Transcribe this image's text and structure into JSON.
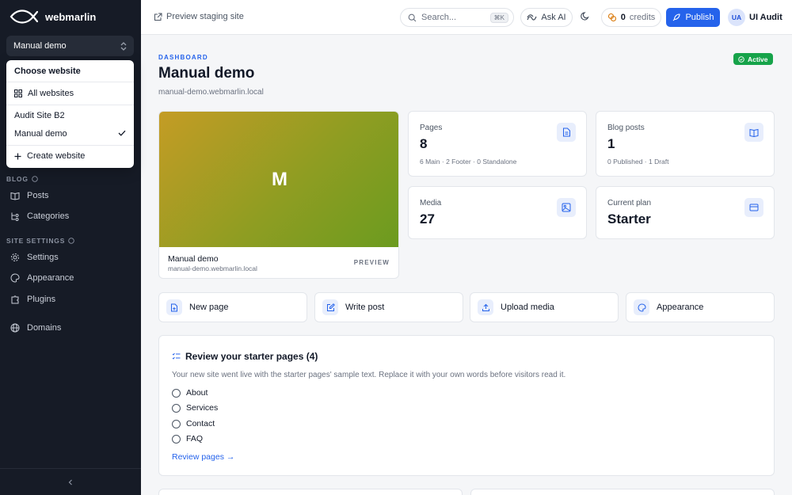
{
  "brand": {
    "name": "webmarlin"
  },
  "site_switcher": {
    "current": "Manual demo"
  },
  "dropdown": {
    "header": "Choose website",
    "all_websites": "All websites",
    "sites": [
      "Audit Site B2",
      "Manual demo"
    ],
    "selected": "Manual demo",
    "create": "Create website"
  },
  "sidebar": {
    "blog_section": "BLOG",
    "blog_items": [
      "Posts",
      "Categories"
    ],
    "settings_section": "SITE SETTINGS",
    "settings_items": [
      "Settings",
      "Appearance",
      "Plugins"
    ],
    "domains": "Domains"
  },
  "topbar": {
    "preview_link": "Preview staging site",
    "search_placeholder": "Search...",
    "search_shortcut": "⌘K",
    "ask_ai": "Ask AI",
    "credits_count": "0",
    "credits_label": "credits",
    "publish": "Publish",
    "user_initials": "UA",
    "user_name": "UI Audit"
  },
  "header": {
    "eyebrow": "DASHBOARD",
    "title": "Manual demo",
    "domain": "manual-demo.webmarlin.local",
    "status": "Active"
  },
  "preview_card": {
    "initial": "M",
    "name": "Manual demo",
    "domain": "manual-demo.webmarlin.local",
    "preview_label": "PREVIEW"
  },
  "stats": {
    "pages": {
      "label": "Pages",
      "value": "8",
      "note": "6 Main · 2 Footer · 0 Standalone"
    },
    "blog": {
      "label": "Blog posts",
      "value": "1",
      "note": "0 Published · 1 Draft"
    },
    "media": {
      "label": "Media",
      "value": "27"
    },
    "plan": {
      "label": "Current plan",
      "value": "Starter"
    }
  },
  "actions": [
    "New page",
    "Write post",
    "Upload media",
    "Appearance"
  ],
  "review": {
    "title": "Review your starter pages (4)",
    "description": "Your new site went live with the starter pages' sample text. Replace it with your own words before visitors read it.",
    "pages": [
      "About",
      "Services",
      "Contact",
      "FAQ"
    ],
    "link": "Review pages →"
  },
  "colors": {
    "accent": "#2563eb",
    "sidebar_bg": "#161b26",
    "active_badge": "#16a34a"
  }
}
